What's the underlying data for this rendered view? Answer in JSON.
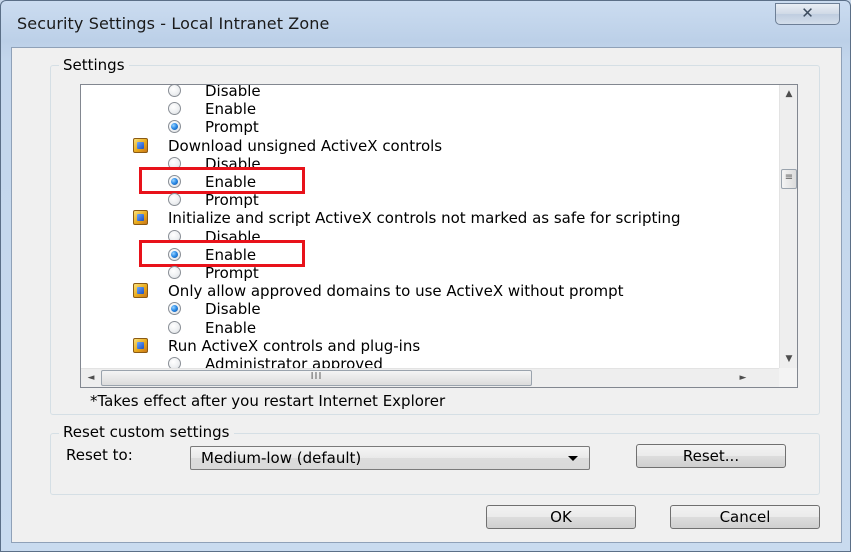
{
  "window": {
    "title": "Security Settings - Local Intranet Zone",
    "close_glyph": "✕"
  },
  "settings_group": {
    "label": "Settings",
    "items": [
      {
        "kind": "option",
        "label": "Disable",
        "checked": false
      },
      {
        "kind": "option",
        "label": "Enable",
        "checked": false
      },
      {
        "kind": "option",
        "label": "Prompt",
        "checked": true
      },
      {
        "kind": "category",
        "label": "Download unsigned ActiveX controls"
      },
      {
        "kind": "option",
        "label": "Disable",
        "checked": false
      },
      {
        "kind": "option",
        "label": "Enable",
        "checked": true,
        "highlighted": true
      },
      {
        "kind": "option",
        "label": "Prompt",
        "checked": false
      },
      {
        "kind": "category",
        "label": "Initialize and script ActiveX controls not marked as safe for scripting"
      },
      {
        "kind": "option",
        "label": "Disable",
        "checked": false
      },
      {
        "kind": "option",
        "label": "Enable",
        "checked": true,
        "highlighted": true
      },
      {
        "kind": "option",
        "label": "Prompt",
        "checked": false
      },
      {
        "kind": "category",
        "label": "Only allow approved domains to use ActiveX without prompt"
      },
      {
        "kind": "option",
        "label": "Disable",
        "checked": true
      },
      {
        "kind": "option",
        "label": "Enable",
        "checked": false
      },
      {
        "kind": "category",
        "label": "Run ActiveX controls and plug-ins"
      },
      {
        "kind": "option",
        "label": "Administrator approved",
        "checked": false
      }
    ],
    "note": "*Takes effect after you restart Internet Explorer"
  },
  "reset_group": {
    "label": "Reset custom settings",
    "reset_to_label": "Reset to:",
    "selected_level": "Medium-low (default)",
    "reset_button": "Reset..."
  },
  "buttons": {
    "ok": "OK",
    "cancel": "Cancel"
  },
  "icons": {
    "category": "activex-setting-icon",
    "scroll_up": "▲",
    "scroll_down": "▼",
    "scroll_left": "◄",
    "scroll_right": "►",
    "vthumb_grip": "≡",
    "hthumb_grip": "III"
  },
  "colors": {
    "highlight_box": "#e8121a",
    "radio_selected": "#2e8de8"
  }
}
